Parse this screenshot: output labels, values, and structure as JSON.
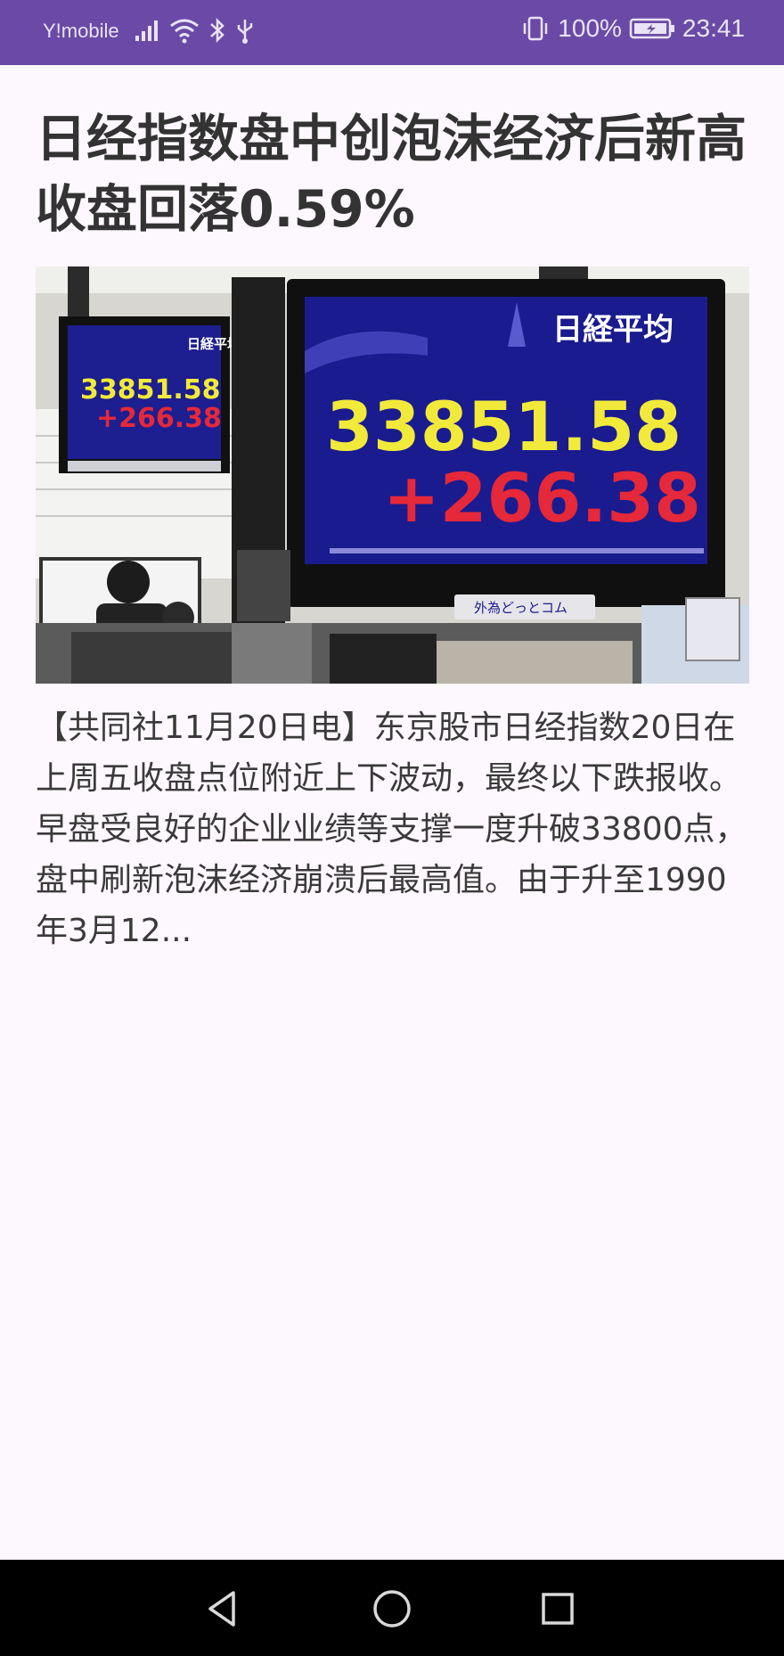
{
  "status_bar": {
    "carrier": "Y!mobile",
    "battery": "100%",
    "time": "23:41",
    "icons": [
      "signal-icon",
      "wifi-icon",
      "bluetooth-icon",
      "usb-icon",
      "vibrate-icon",
      "battery-charging-icon"
    ]
  },
  "article": {
    "title": "日经指数盘中创泡沫经济后新高 收盘回落0.59%",
    "image": {
      "board_label": "日経平均",
      "index_value": "33851.58",
      "change_value": "+266.38",
      "sponsor": "外為どっとコム"
    },
    "summary": "【共同社11月20日电】东京股市日经指数20日在上周五收盘点位附近上下波动，最终以下跌报收。早盘受良好的企业业绩等支撑一度升破33800点，盘中刷新泡沫经济崩溃后最高值。由于升至1990年3月12..."
  },
  "nav_bar": {
    "icons": [
      "back-icon",
      "home-icon",
      "recents-icon"
    ]
  },
  "colors": {
    "status_bar": "#6a4aa6",
    "background": "#fdf8fd",
    "title_text": "#333333",
    "board_blue": "#1a1b8e",
    "board_yellow": "#f2ea3a",
    "board_red": "#e5283a"
  }
}
